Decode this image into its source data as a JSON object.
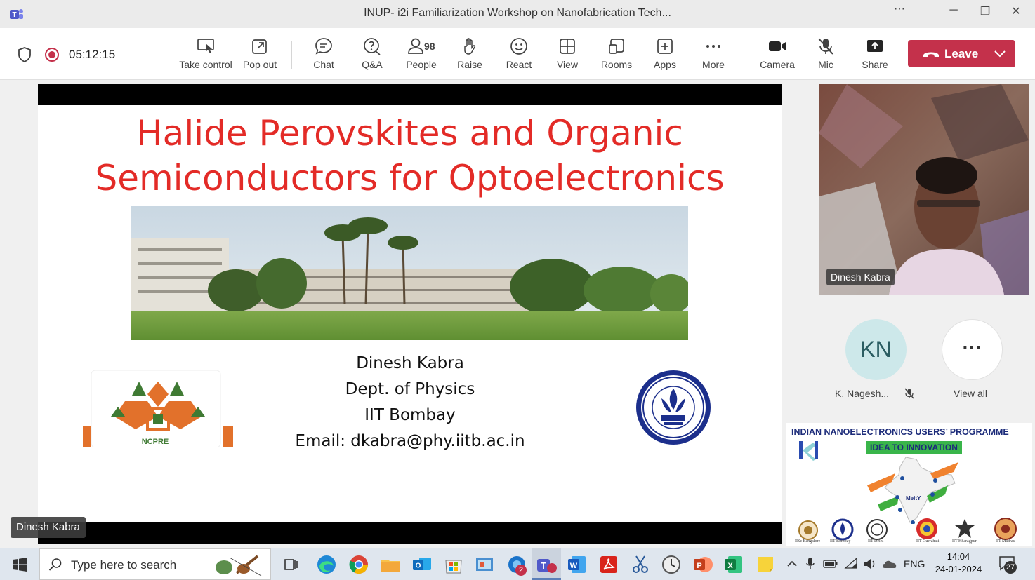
{
  "window": {
    "title": "INUP- i2i Familiarization Workshop on Nanofabrication Tech...",
    "more": "···",
    "minimize": "─",
    "restore": "❐",
    "close": "✕"
  },
  "toolbar": {
    "timer": "05:12:15",
    "take_control": "Take control",
    "pop_out": "Pop out",
    "chat": "Chat",
    "qa": "Q&A",
    "people": "People",
    "people_count": "98",
    "raise": "Raise",
    "react": "React",
    "view": "View",
    "rooms": "Rooms",
    "apps": "Apps",
    "more": "More",
    "camera": "Camera",
    "mic": "Mic",
    "share": "Share",
    "leave": "Leave"
  },
  "slide": {
    "title_line1": "Halide Perovskites and Organic",
    "title_line2": "Semiconductors for Optoelectronics",
    "author_name": "Dinesh Kabra",
    "author_dept": "Dept. of Physics",
    "author_inst": "IIT Bombay",
    "author_email": "Email: dkabra@phy.iitb.ac.in",
    "ncpre_logo_text": "NCPRE",
    "presenter_tag": "Dinesh Kabra"
  },
  "participants": {
    "video_name": "Dinesh Kabra",
    "avatar_initials": "KN",
    "avatar_name": "K. Nagesh...",
    "view_all": "View all",
    "view_all_icon": "···"
  },
  "inup_banner": {
    "title": "INDIAN NANOELECTRONICS USERS’ PROGRAMME",
    "tagline": "IDEA TO INNOVATION",
    "center_label": "MeitY",
    "institutes": [
      "IISc Bangalore",
      "IIT Bombay",
      "IIT Delhi",
      "IIT Guwahati",
      "IIT Kharagpur",
      "IIT Madras"
    ]
  },
  "taskbar": {
    "search_placeholder": "Type here to search",
    "language": "ENG",
    "time": "14:04",
    "date": "24-01-2024",
    "notifications": "27",
    "outlook_badge": "2"
  },
  "colors": {
    "leave": "#c4314b",
    "slide_title": "#e32b27",
    "ncpre_orange": "#e2712b",
    "ncpre_green": "#3f7a33",
    "iitb_blue": "#1c2f8c"
  }
}
